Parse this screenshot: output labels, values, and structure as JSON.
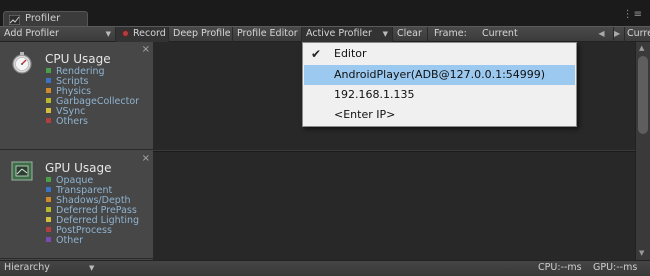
{
  "window": {
    "tab_title": "Profiler",
    "menu_glyph": "⋮≡"
  },
  "toolbar": {
    "add_profiler": "Add Profiler",
    "record": "Record",
    "deep_profile": "Deep Profile",
    "profile_editor": "Profile Editor",
    "active_profiler": "Active Profiler",
    "clear": "Clear",
    "frame_label": "Frame:",
    "current": "Current",
    "prev_arrow": "◀",
    "next_arrow": "▶",
    "current_right": "Curre"
  },
  "cpu": {
    "title": "CPU Usage",
    "close": "×",
    "legend": [
      {
        "label": "Rendering",
        "color": "#4a9f4a"
      },
      {
        "label": "Scripts",
        "color": "#3a73c4"
      },
      {
        "label": "Physics",
        "color": "#d08a2a"
      },
      {
        "label": "GarbageCollector",
        "color": "#b8b82a"
      },
      {
        "label": "VSync",
        "color": "#d2c03a"
      },
      {
        "label": "Others",
        "color": "#b04040"
      }
    ]
  },
  "gpu": {
    "title": "GPU Usage",
    "close": "×",
    "legend": [
      {
        "label": "Opaque",
        "color": "#4a9f4a"
      },
      {
        "label": "Transparent",
        "color": "#3a73c4"
      },
      {
        "label": "Shadows/Depth",
        "color": "#d08a2a"
      },
      {
        "label": "Deferred PrePass",
        "color": "#b8b82a"
      },
      {
        "label": "Deferred Lighting",
        "color": "#d2c03a"
      },
      {
        "label": "PostProcess",
        "color": "#b04040"
      },
      {
        "label": "Other",
        "color": "#7a4ab0"
      }
    ]
  },
  "dropdown": {
    "items": [
      {
        "label": "Editor",
        "checked": true,
        "highlighted": false
      },
      {
        "label": "AndroidPlayer(ADB@127.0.0.1:54999)",
        "checked": false,
        "highlighted": true
      },
      {
        "label": "192.168.1.135",
        "checked": false,
        "highlighted": false
      },
      {
        "label": "<Enter IP>",
        "checked": false,
        "highlighted": false
      }
    ],
    "check_glyph": "✔"
  },
  "status": {
    "hierarchy": "Hierarchy",
    "cpu": "CPU:--ms",
    "gpu": "GPU:--ms"
  }
}
